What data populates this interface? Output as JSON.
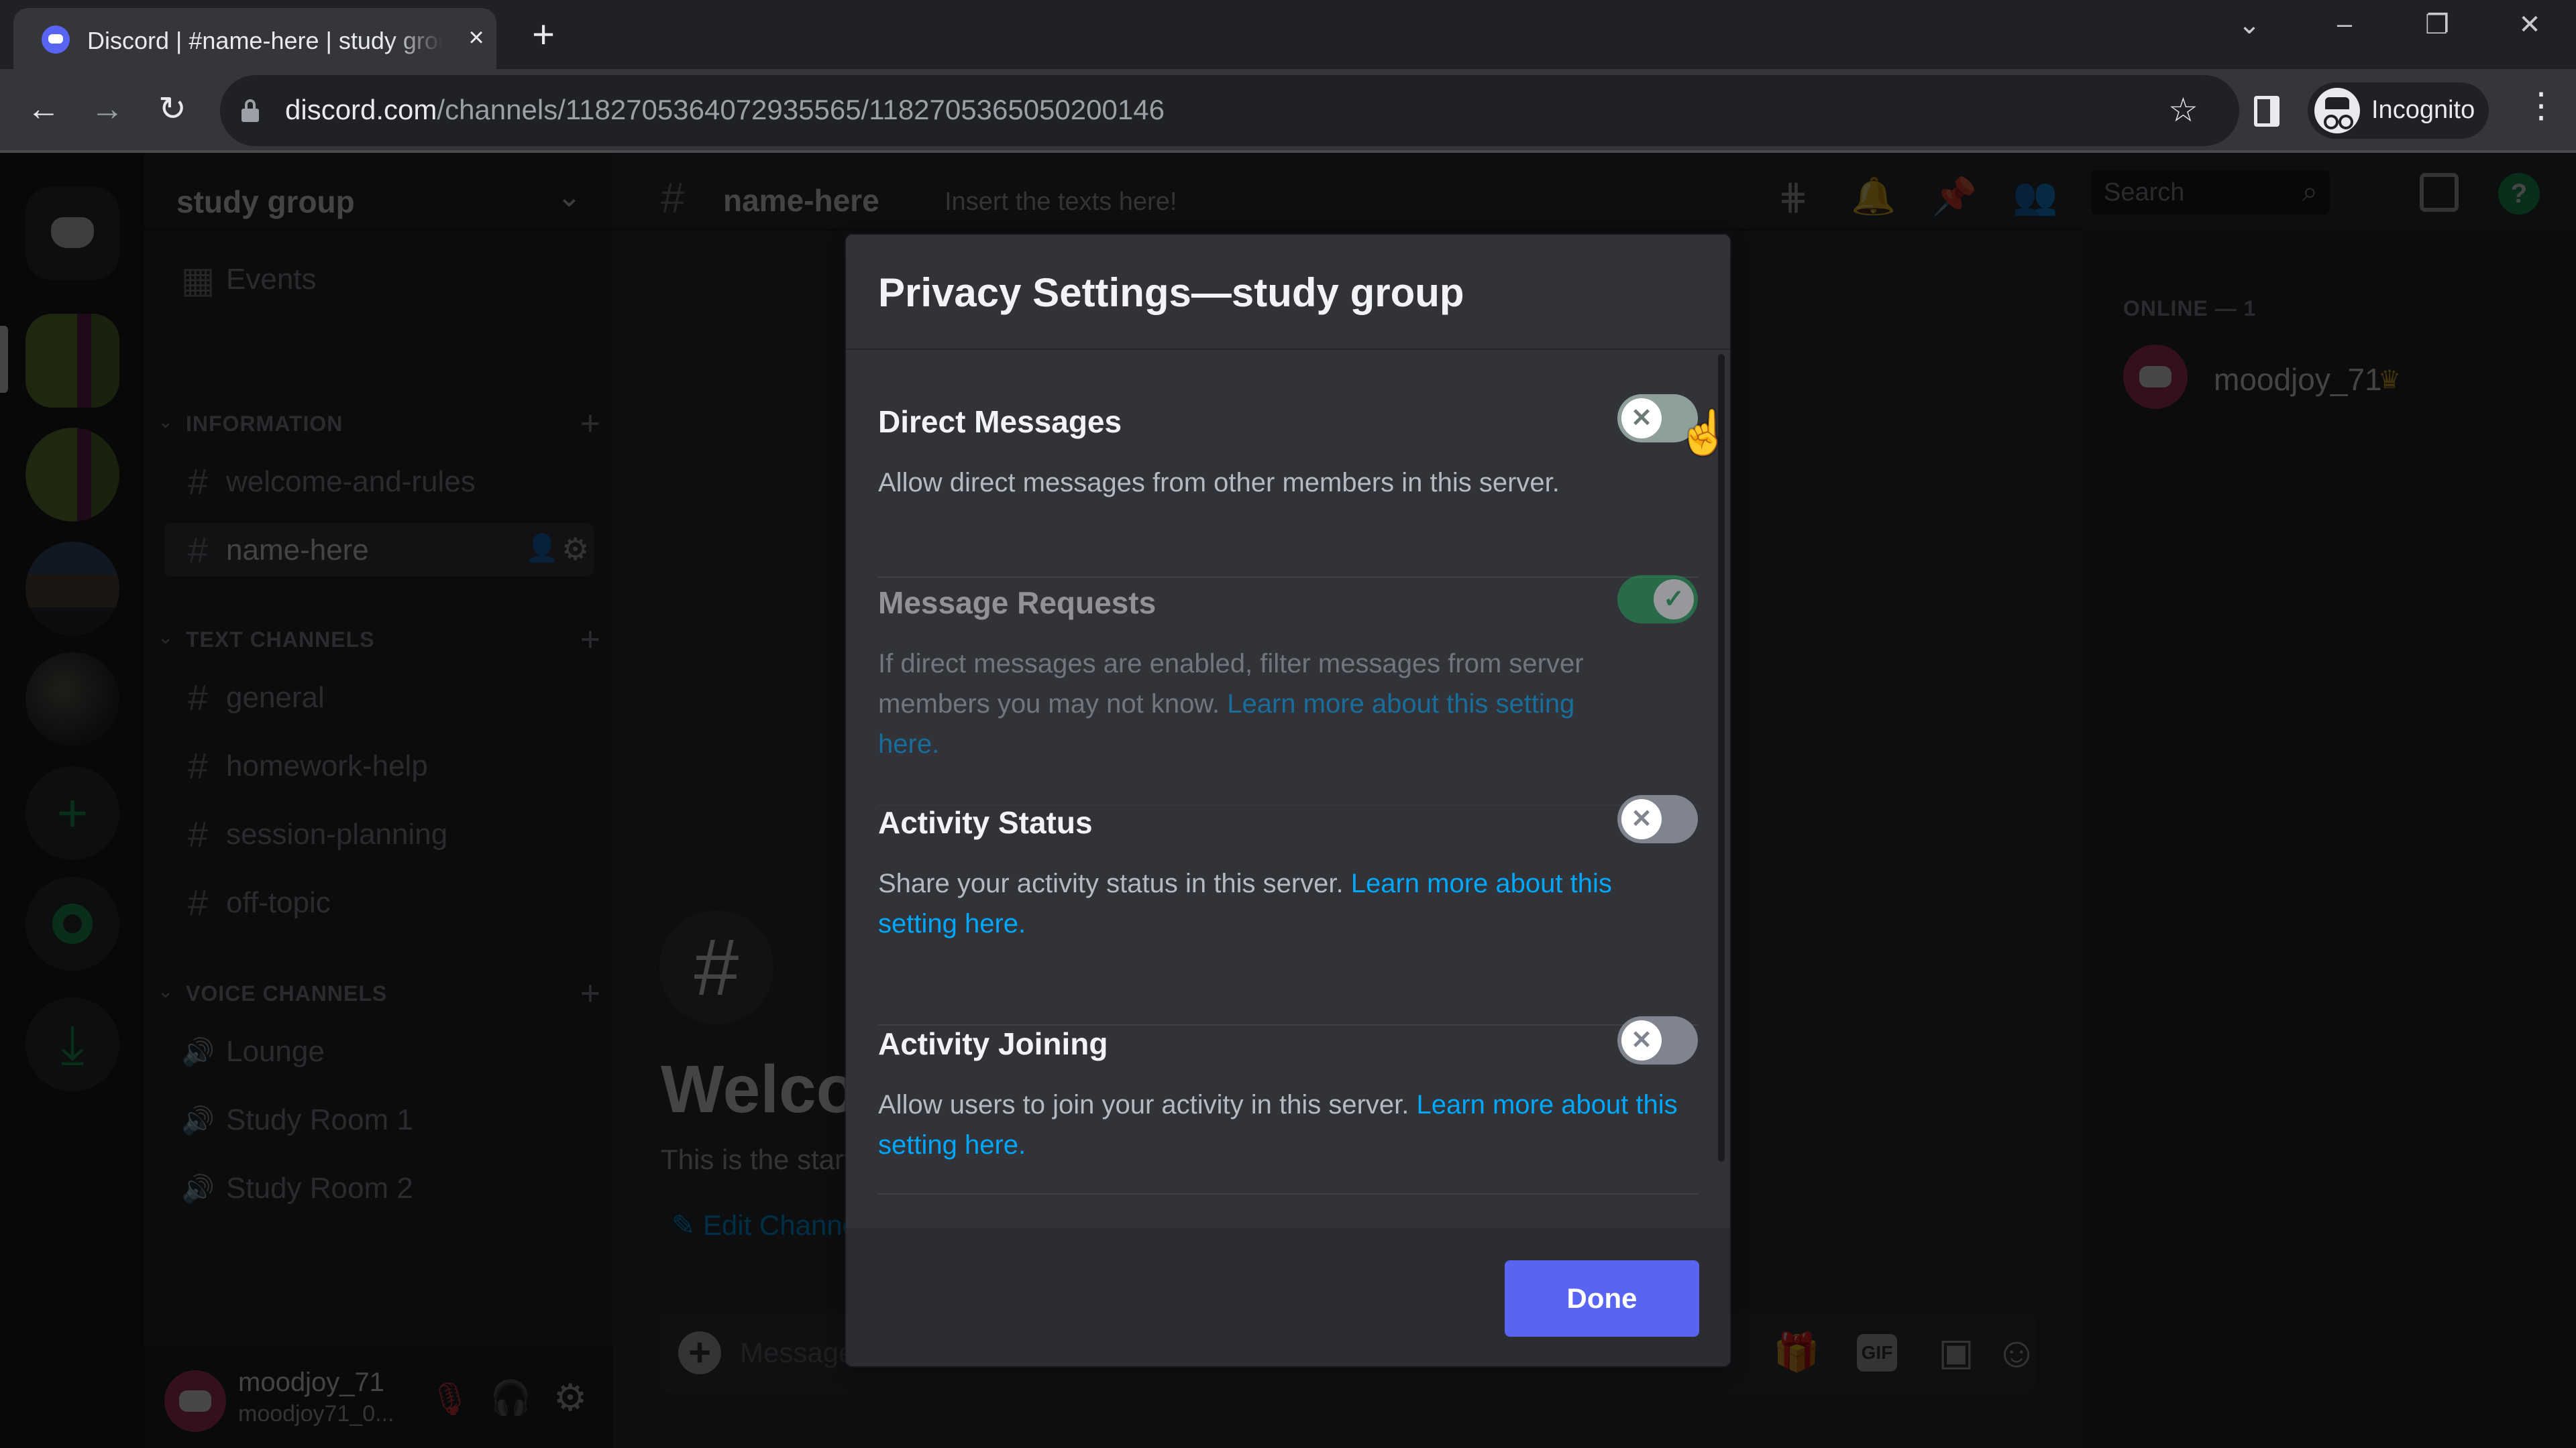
{
  "browser": {
    "tab_title": "Discord | #name-here | study group",
    "tab_close": "×",
    "new_tab": "+",
    "window_controls": {
      "tab_search": "⌄",
      "minimize": "–",
      "restore": "❐",
      "close": "✕"
    },
    "nav": {
      "back": "←",
      "forward": "→",
      "reload": "↻"
    },
    "url_host": "discord.com",
    "url_path": "/channels/1182705364072935565/1182705365050200146",
    "bookmark_icon": "☆",
    "profile_label": "Incognito",
    "menu_icon": "⋮"
  },
  "discord": {
    "server_name": "study group",
    "server_chevron": "⌄",
    "events_label": "Events",
    "events_icon": "▦",
    "add_server_icon": "+",
    "download_icon": "⤓",
    "categories": [
      {
        "name": "INFORMATION",
        "channels": [
          {
            "name": "welcome-and-rules",
            "icon": "#"
          },
          {
            "name": "name-here",
            "icon": "#",
            "selected": true
          }
        ]
      },
      {
        "name": "TEXT CHANNELS",
        "channels": [
          {
            "name": "general",
            "icon": "#"
          },
          {
            "name": "homework-help",
            "icon": "#"
          },
          {
            "name": "session-planning",
            "icon": "#"
          },
          {
            "name": "off-topic",
            "icon": "#"
          }
        ]
      },
      {
        "name": "VOICE CHANNELS",
        "channels": [
          {
            "name": "Lounge",
            "icon": "🔊"
          },
          {
            "name": "Study Room 1",
            "icon": "🔊"
          },
          {
            "name": "Study Room 2",
            "icon": "🔊"
          }
        ]
      }
    ],
    "category_chevron": "⌄",
    "category_add": "+",
    "selected_channel_actions": {
      "invite": "👤",
      "settings": "⚙"
    },
    "user": {
      "name": "moodjoy_71",
      "tag": "moodjoy71_0...",
      "mic_icon": "🎙",
      "headset_icon": "🎧",
      "settings_icon": "⚙"
    },
    "chat_header": {
      "hash": "#",
      "channel_name": "name-here",
      "topic": "Insert the texts here!",
      "icons": {
        "threads": "⋕",
        "notifications": "🔔",
        "pinned": "📌",
        "members": "👥"
      },
      "search_placeholder": "Search",
      "search_icon": "⌕",
      "help_icon": "?"
    },
    "welcome": {
      "hash": "#",
      "title": "Welcome to #name-here!",
      "subtitle": "This is the start of the #name-here channel.",
      "edit_channel": "✎ Edit Channel"
    },
    "composer": {
      "placeholder": "Message #name-here",
      "plus": "+",
      "gift_icon": "🎁",
      "gif_label": "GIF",
      "sticker_icon": "▣",
      "emoji_icon": "☺"
    },
    "members": {
      "online_header": "ONLINE — 1",
      "list": [
        {
          "name": "moodjoy_71",
          "owner_icon": "♛"
        }
      ]
    }
  },
  "modal": {
    "title": "Privacy Settings—study group",
    "settings": [
      {
        "title": "Direct Messages",
        "description": "Allow direct messages from other members in this server.",
        "link": "",
        "enabled": false,
        "disabled": false
      },
      {
        "title": "Message Requests",
        "description": "If direct messages are enabled, filter messages from server members you may not know. ",
        "link": "Learn more about this setting here.",
        "enabled": true,
        "disabled": true
      },
      {
        "title": "Activity Status",
        "description": "Share your activity status in this server. ",
        "link": "Learn more about this setting here.",
        "enabled": false,
        "disabled": false
      },
      {
        "title": "Activity Joining",
        "description": "Allow users to join your activity in this server. ",
        "link": "Learn more about this setting here.",
        "enabled": false,
        "disabled": false
      }
    ],
    "toggle_off_glyph": "✕",
    "toggle_on_glyph": "✓",
    "done_label": "Done"
  },
  "colors": {
    "blurple": "#5865f2",
    "green": "#23a559",
    "link": "#00a8fc",
    "modal_bg": "#313338"
  }
}
